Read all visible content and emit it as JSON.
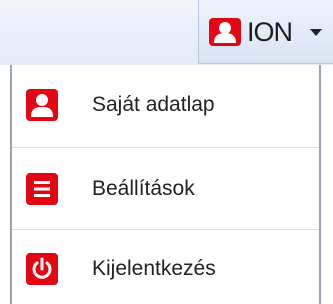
{
  "header": {
    "user_name": "ION",
    "user_icon": "user-icon",
    "dropdown_icon": "caret-down-icon"
  },
  "menu": {
    "items": [
      {
        "label": "Saját adatlap",
        "icon": "user-icon"
      },
      {
        "label": "Beállítások",
        "icon": "list-icon"
      },
      {
        "label": "Kijelentkezés",
        "icon": "power-icon"
      }
    ]
  },
  "colors": {
    "accent": "#e30613",
    "topbar": "#e3ebf5",
    "border": "#9aa4b0"
  }
}
